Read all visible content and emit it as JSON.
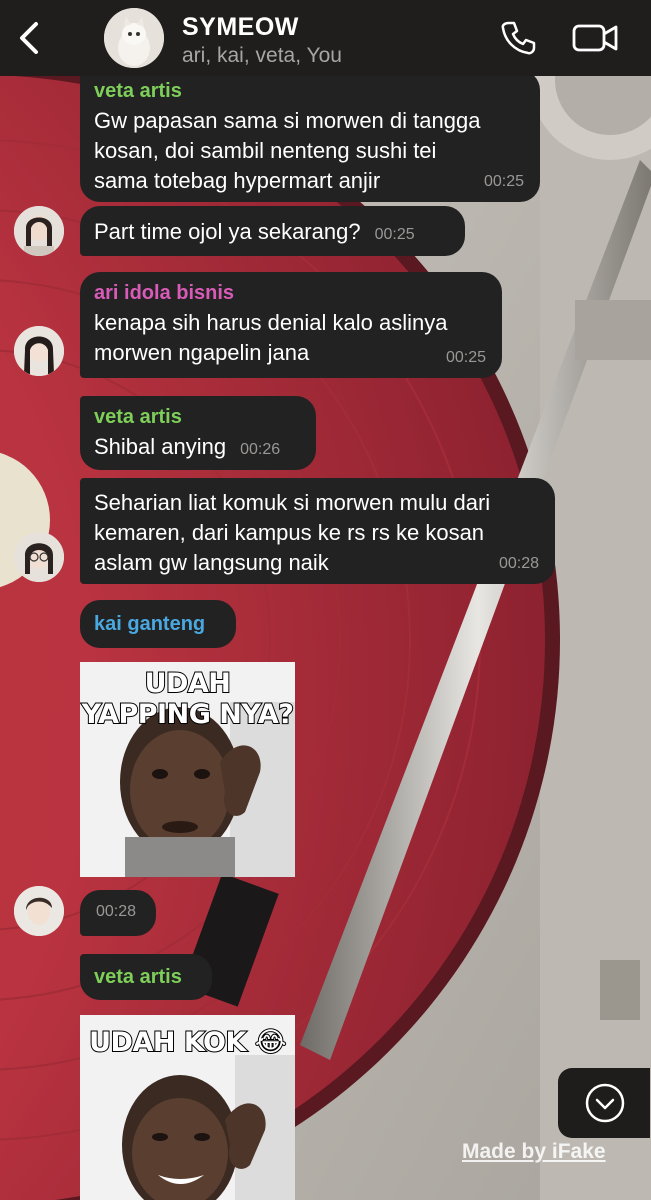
{
  "header": {
    "title": "SYMEOW",
    "members": "ari, kai, veta, You",
    "avatar_icon": "cat-group-avatar"
  },
  "colors": {
    "veta": "#7ecf5a",
    "ari": "#d85bb8",
    "kai": "#4aa8e0",
    "bubble": "#222222",
    "header": "#201e1c"
  },
  "messages": [
    {
      "sender": "veta artis",
      "text_lines": [
        "Gw papasan sama si morwen di tangga",
        "kosan, doi sambil nenteng sushi tei",
        "sama totebag hypermart anjir"
      ],
      "time": "00:25"
    },
    {
      "sender": "",
      "text_lines": [
        "Part time ojol ya sekarang?"
      ],
      "time": "00:25"
    },
    {
      "sender": "ari idola bisnis",
      "text_lines": [
        "kenapa sih harus denial kalo aslinya",
        "morwen ngapelin jana"
      ],
      "time": "00:25"
    },
    {
      "sender": "veta artis",
      "text_lines": [
        "Shibal anying"
      ],
      "time": "00:26"
    },
    {
      "sender": "",
      "text_lines": [
        "Seharian liat komuk si morwen mulu dari",
        "kemaren, dari kampus ke rs rs ke kosan",
        "aslam gw langsung naik"
      ],
      "time": "00:28"
    },
    {
      "sender": "kai ganteng",
      "sticker_caption": "UDAH YAPPING NYA?",
      "time": "00:28"
    },
    {
      "sender": "veta artis",
      "sticker_caption": "UDAH KOK 😂"
    }
  ],
  "watermark": "Made by iFake"
}
